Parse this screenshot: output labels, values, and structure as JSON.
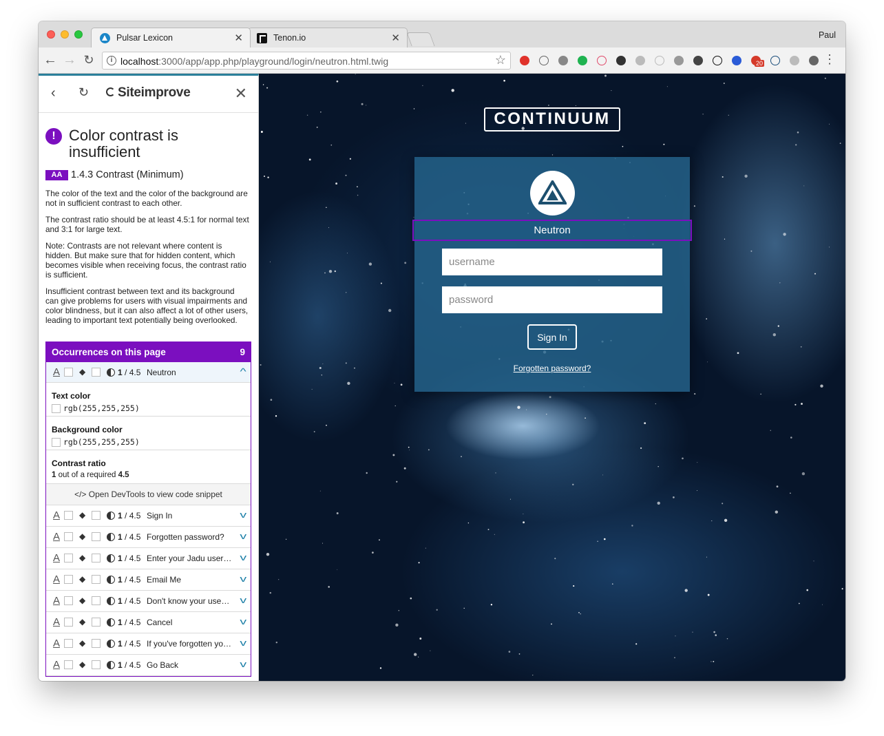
{
  "browser": {
    "tabs": [
      {
        "title": "Pulsar Lexicon",
        "close": "✕"
      },
      {
        "title": "Tenon.io",
        "close": "✕"
      }
    ],
    "profile": "Paul",
    "url_host": "localhost",
    "url_path": ":3000/app/app.php/playground/login/neutron.html.twig",
    "extensions": [
      {
        "icon": "opera-icon",
        "color": "#e0322b"
      },
      {
        "icon": "info-ext-icon",
        "color": "#666666"
      },
      {
        "icon": "draw-icon",
        "color": "#888888"
      },
      {
        "icon": "speech-icon",
        "color": "#1fb351"
      },
      {
        "icon": "record-icon",
        "color": "#e04a6a"
      },
      {
        "icon": "color-wheel-icon",
        "color": "#333333"
      },
      {
        "icon": "camera-icon",
        "color": "#bbbbbb"
      },
      {
        "icon": "drive-icon",
        "color": "#bbbbbb"
      },
      {
        "icon": "screen-icon",
        "color": "#999999"
      },
      {
        "icon": "w-icon",
        "color": "#444444"
      },
      {
        "icon": "tenon-icon",
        "color": "#111111"
      },
      {
        "icon": "css-icon",
        "color": "#2a5bd7"
      },
      {
        "icon": "badge-20-icon",
        "color": "#d53a2a",
        "badge": "20"
      },
      {
        "icon": "triangle-icon",
        "color": "#1a4d7a"
      },
      {
        "icon": "gear-ext-icon",
        "color": "#bbbbbb"
      },
      {
        "icon": "check-ext-icon",
        "color": "#666666"
      }
    ]
  },
  "sidebar": {
    "brand": "Siteimprove",
    "issue_title": "Color contrast is insufficient",
    "wcag_level": "AA",
    "wcag_criterion": "1.4.3 Contrast (Minimum)",
    "paragraphs": [
      "The color of the text and the color of the background are not in sufficient contrast to each other.",
      "The contrast ratio should be at least 4.5:1 for normal text and 3:1 for large text.",
      "Note: Contrasts are not relevant where content is hidden. But make sure that for hidden content, which becomes visible when receiving focus, the contrast ratio is sufficient.",
      "Insufficient contrast between text and its background can give problems for users with visual impairments and color blindness, but it can also affect a lot of other users, leading to important text potentially being overlooked."
    ],
    "occurrences": {
      "title": "Occurrences on this page",
      "count": "9",
      "ratio_value": "1",
      "ratio_required": "/ 4.5",
      "items": [
        "Neutron",
        "Sign In",
        "Forgotten password?",
        "Enter your Jadu username",
        "Email Me",
        "Don't know your username?",
        "Cancel",
        "If you've forgotten your password",
        "Go Back"
      ],
      "detail": {
        "text_color_label": "Text color",
        "text_color": "rgb(255,255,255)",
        "bg_color_label": "Background color",
        "bg_color": "rgb(255,255,255)",
        "ratio_label": "Contrast ratio",
        "ratio_value": "1",
        "ratio_text": "out of a required",
        "ratio_required": "4.5",
        "devtools_note": "</> Open DevTools to view code snippet"
      }
    }
  },
  "page": {
    "brand": "CONTINUUM",
    "app_name": "Neutron",
    "username_placeholder": "username",
    "password_placeholder": "password",
    "sign_in": "Sign In",
    "forgot": "Forgotten password?"
  },
  "colors": {
    "siteimprove_purple": "#7b0fbf",
    "card_blue": "#24648c",
    "accent_teal": "#2a7f9a"
  }
}
